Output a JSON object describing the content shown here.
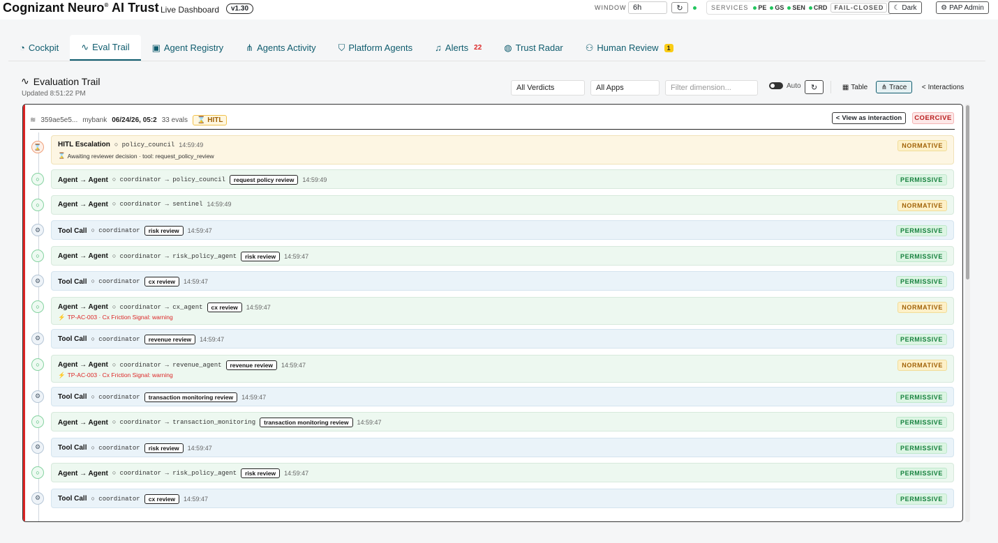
{
  "header": {
    "brand": "Cognizant Neuro",
    "brand_mark": "®",
    "brand_suffix": "AI Trust",
    "subtitle": "Live Dashboard",
    "version": "v1.30",
    "window_label": "WINDOW",
    "window_value": "6h",
    "services_label": "SERVICES",
    "services": [
      "PE",
      "GS",
      "SEN",
      "CRD"
    ],
    "fail_mode": "FAIL-CLOSED",
    "theme_label": "Dark",
    "admin_label": "PAP Admin"
  },
  "tabs": [
    {
      "label": "Cockpit",
      "icon": "gauge-icon"
    },
    {
      "label": "Eval Trail",
      "icon": "pulse-icon"
    },
    {
      "label": "Agent Registry",
      "icon": "id-badge-icon"
    },
    {
      "label": "Agents Activity",
      "icon": "hierarchy-icon"
    },
    {
      "label": "Platform Agents",
      "icon": "shield-icon"
    },
    {
      "label": "Alerts",
      "icon": "bell-icon",
      "count": "22"
    },
    {
      "label": "Trust Radar",
      "icon": "radar-icon"
    },
    {
      "label": "Human Review",
      "icon": "user-gear-icon",
      "badge": "1"
    }
  ],
  "trail": {
    "title": "Evaluation Trail",
    "updated": "Updated 8:51:22 PM",
    "filters": {
      "verdicts": "All Verdicts",
      "apps": "All Apps",
      "dimension_placeholder": "Filter dimension..."
    },
    "auto_label": "Auto",
    "views": [
      "Table",
      "Trace",
      "Interactions"
    ],
    "session": {
      "id": "359ae5e5...",
      "app": "mybank",
      "date": "06/24/26, 05:2",
      "evals": "33 evals",
      "hitl": "HITL",
      "view_interaction": "View as interaction",
      "verdict": "COERCIVE"
    },
    "rows": [
      {
        "kind": "hitl",
        "title": "HITL Escalation",
        "meta": "policy_council",
        "time": "14:59:49",
        "detail": "Awaiting reviewer decision · tool: request_policy_review",
        "verdict": "NORMATIVE"
      },
      {
        "kind": "agent",
        "title": "Agent → Agent",
        "meta": "coordinator → policy_council",
        "tag": "request policy review",
        "time": "14:59:49",
        "verdict": "PERMISSIVE"
      },
      {
        "kind": "agent",
        "title": "Agent → Agent",
        "meta": "coordinator → sentinel",
        "time": "14:59:49",
        "verdict": "NORMATIVE"
      },
      {
        "kind": "tool",
        "title": "Tool Call",
        "meta": "coordinator",
        "tag": "risk review",
        "time": "14:59:47",
        "verdict": "PERMISSIVE"
      },
      {
        "kind": "agent",
        "title": "Agent → Agent",
        "meta": "coordinator → risk_policy_agent",
        "tag": "risk review",
        "time": "14:59:47",
        "verdict": "PERMISSIVE"
      },
      {
        "kind": "tool",
        "title": "Tool Call",
        "meta": "coordinator",
        "tag": "cx review",
        "time": "14:59:47",
        "verdict": "PERMISSIVE"
      },
      {
        "kind": "agent",
        "title": "Agent → Agent",
        "meta": "coordinator → cx_agent",
        "tag": "cx review",
        "time": "14:59:47",
        "warning": "TP-AC-003 · Cx Friction Signal: warning",
        "verdict": "NORMATIVE"
      },
      {
        "kind": "tool",
        "title": "Tool Call",
        "meta": "coordinator",
        "tag": "revenue review",
        "time": "14:59:47",
        "verdict": "PERMISSIVE"
      },
      {
        "kind": "agent",
        "title": "Agent → Agent",
        "meta": "coordinator → revenue_agent",
        "tag": "revenue review",
        "time": "14:59:47",
        "warning": "TP-AC-003 · Cx Friction Signal: warning",
        "verdict": "NORMATIVE"
      },
      {
        "kind": "tool",
        "title": "Tool Call",
        "meta": "coordinator",
        "tag": "transaction monitoring review",
        "time": "14:59:47",
        "verdict": "PERMISSIVE"
      },
      {
        "kind": "agent",
        "title": "Agent → Agent",
        "meta": "coordinator → transaction_monitoring",
        "tag": "transaction monitoring review",
        "time": "14:59:47",
        "verdict": "PERMISSIVE"
      },
      {
        "kind": "tool",
        "title": "Tool Call",
        "meta": "coordinator",
        "tag": "risk review",
        "time": "14:59:47",
        "verdict": "PERMISSIVE"
      },
      {
        "kind": "agent",
        "title": "Agent → Agent",
        "meta": "coordinator → risk_policy_agent",
        "tag": "risk review",
        "time": "14:59:47",
        "verdict": "PERMISSIVE"
      },
      {
        "kind": "tool",
        "title": "Tool Call",
        "meta": "coordinator",
        "tag": "cx review",
        "time": "14:59:47",
        "verdict": "PERMISSIVE"
      }
    ]
  },
  "colors": {
    "accent": "#0f5c6e",
    "permissive": "#15803d",
    "normative": "#a16207",
    "coercive": "#b91c1c",
    "alert": "#dc2626"
  }
}
